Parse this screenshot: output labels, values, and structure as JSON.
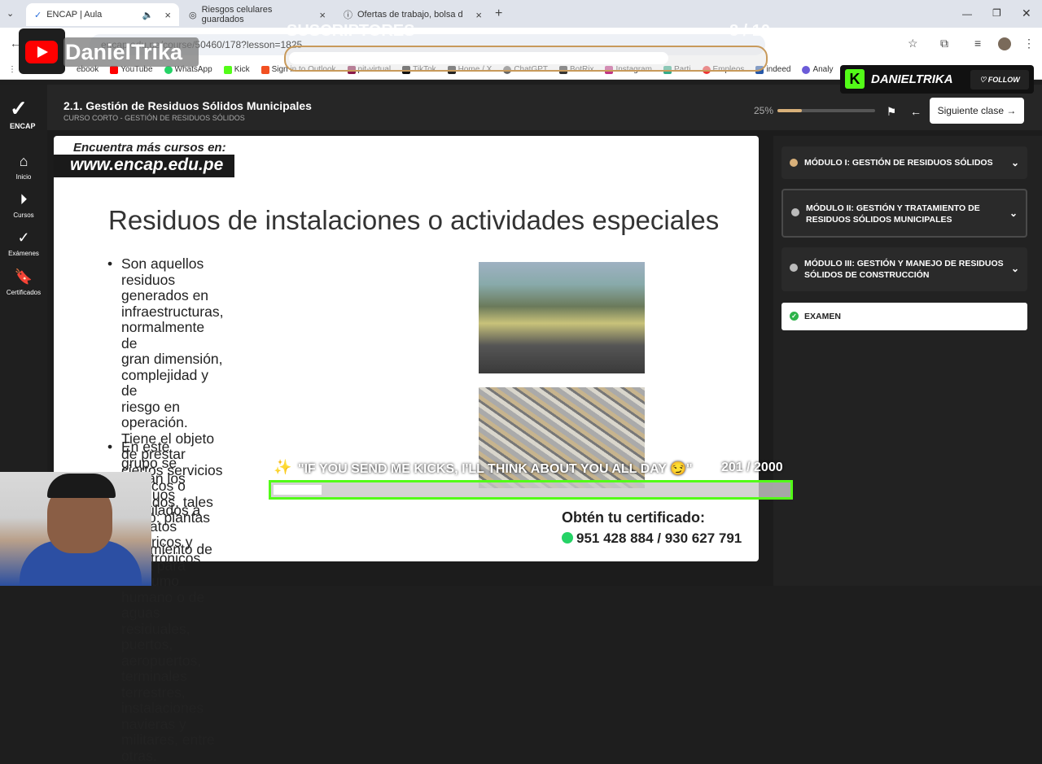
{
  "browser": {
    "tabs": [
      {
        "title": "ENCAP | Aula",
        "active": true
      },
      {
        "title": "Riesgos celulares guardados",
        "active": false
      },
      {
        "title": "Ofertas de trabajo, bolsa de tra",
        "active": false
      }
    ],
    "new_tab": "+",
    "url": "encap.edu.pe/course/50460/178?lesson=1825",
    "bookmarks": [
      "ebook",
      "YouTube",
      "WhatsApp",
      "Kick",
      "Sign in to Outlook",
      "pit-virtual",
      "TikTok",
      "Home / X",
      "ChatGPT",
      "BotRix",
      "Instagram",
      "Parti",
      "Empleos",
      "indeed",
      "Analy"
    ]
  },
  "nav": {
    "logo": "ENCAP",
    "items": [
      {
        "label": "Inicio",
        "icon": "home-icon"
      },
      {
        "label": "Cursos",
        "icon": "play-icon"
      },
      {
        "label": "Exámenes",
        "icon": "check-icon"
      },
      {
        "label": "Certificados",
        "icon": "bookmark-icon"
      }
    ]
  },
  "header": {
    "title": "2.1. Gestión de Residuos Sólidos Municipales",
    "subtitle": "CURSO CORTO - GESTIÓN DE RESIDUOS SÓLIDOS",
    "progress_label": "25%",
    "progress": 0.25,
    "next_label": "Siguiente clase"
  },
  "slide": {
    "promo_line1": "Encuentra más cursos en:",
    "promo_line2": "www.encap.edu.pe",
    "title": "Residuos de instalaciones o actividades especiales",
    "bullet1": [
      "Son aquellos residuos generados en",
      "infraestructuras, normalmente de",
      "gran dimensión, complejidad y de",
      "riesgo en operación. Tiene el objeto",
      "de prestar ciertos servicios públicos o",
      "privados, tales como: plantas de",
      "tratamiento de agua para consumo",
      "humano o de aguas residuales,",
      "puertos, aeropuertos, terminales",
      "terrestres, instalaciones navieras y",
      "militares, entre otras."
    ],
    "bullet2": [
      "En este grupo se ubican los residuos",
      "vinculados a aparatos eléctricos y",
      "trónicos"
    ],
    "cert_title": "Obtén tu certificado:",
    "cert_phone": "951 428 884 / 930 627 791"
  },
  "modules": [
    {
      "label": "MÓDULO I: GESTIÓN DE RESIDUOS SÓLIDOS"
    },
    {
      "label": "MÓDULO II: GESTIÓN Y TRATAMIENTO DE RESIDUOS SÓLIDOS MUNICIPALES"
    },
    {
      "label": "MÓDULO III: GESTIÓN Y MANEJO DE RESIDUOS SÓLIDOS DE CONSTRUCCIÓN"
    }
  ],
  "exam_label": "EXAMEN",
  "overlay": {
    "yt_name": "DanielTrika",
    "subs_label": "SUSCRIPTORES",
    "subs_count": "8 / 10",
    "subs_progress": 0.8,
    "kick_name": "DANIELTRIKA",
    "kick_follow": "FOLLOW",
    "kick_goal": "\"IF YOU SEND ME KICKS, I'LL THINK ABOUT YOU ALL DAY 😏\"",
    "kick_count": "201 / 2000",
    "kick_progress": 0.1005
  },
  "colors": {
    "accent": "#d8b07a",
    "kick": "#53fc18",
    "youtube": "#ff0000"
  }
}
